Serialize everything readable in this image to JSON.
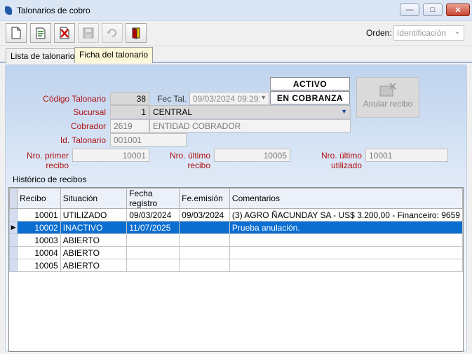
{
  "window": {
    "title": "Talonarios de cobro"
  },
  "toolbar": {
    "buttons": [
      {
        "icon": "new-document-icon"
      },
      {
        "icon": "edit-document-icon"
      },
      {
        "icon": "delete-document-icon"
      },
      {
        "icon": "save-disk-icon"
      },
      {
        "icon": "undo-icon"
      },
      {
        "icon": "exit-door-icon"
      }
    ],
    "orden_label": "Orden:",
    "orden_value": "Identificación"
  },
  "tabs": [
    {
      "label": "Lista de talonarios",
      "active": false
    },
    {
      "label": "Ficha del talonario",
      "active": true
    }
  ],
  "form": {
    "codigo_label": "Código Talonario",
    "codigo_value": "38",
    "fec_tal_label": "Fec Tal.",
    "fec_tal_value": "09/03/2024 09:29:",
    "status_activo": "ACTIVO",
    "status_cobranza": "EN COBRANZA",
    "anular_label": "Anular recibo",
    "sucursal_label": "Sucursal",
    "sucursal_code": "1",
    "sucursal_name": "CENTRAL",
    "cobrador_label": "Cobrador",
    "cobrador_code": "2619",
    "cobrador_name": "ENTIDAD COBRADOR",
    "id_label": "Id. Talonario",
    "id_value": "001001",
    "primer_label": "Nro. primer recibo",
    "primer_value": "10001",
    "ultimo_label": "Nro. último recibo",
    "ultimo_value": "10005",
    "utilizado_label": "Nro. último utilizado",
    "utilizado_value": "10001"
  },
  "historico": {
    "label": "Histórico de recibos",
    "columns": [
      "Recibo",
      "Situación",
      "Fecha registro",
      "Fe.emisión",
      "Comentarios"
    ],
    "rows": [
      {
        "recibo": "10001",
        "situacion": "UTILIZADO",
        "fecha_registro": "09/03/2024",
        "fe_emision": "09/03/2024",
        "comentarios": "(3) AGRO ÑACUNDAY SA - US$ 3.200,00 - Financeiro: 9659"
      },
      {
        "recibo": "10002",
        "situacion": "INACTIVO",
        "fecha_registro": "11/07/2025",
        "fe_emision": "",
        "comentarios": "Prueba anulación."
      },
      {
        "recibo": "10003",
        "situacion": "ABIERTO",
        "fecha_registro": "",
        "fe_emision": "",
        "comentarios": ""
      },
      {
        "recibo": "10004",
        "situacion": "ABIERTO",
        "fecha_registro": "",
        "fe_emision": "",
        "comentarios": ""
      },
      {
        "recibo": "10005",
        "situacion": "ABIERTO",
        "fecha_registro": "",
        "fe_emision": "",
        "comentarios": ""
      }
    ],
    "selected_row": 1
  }
}
